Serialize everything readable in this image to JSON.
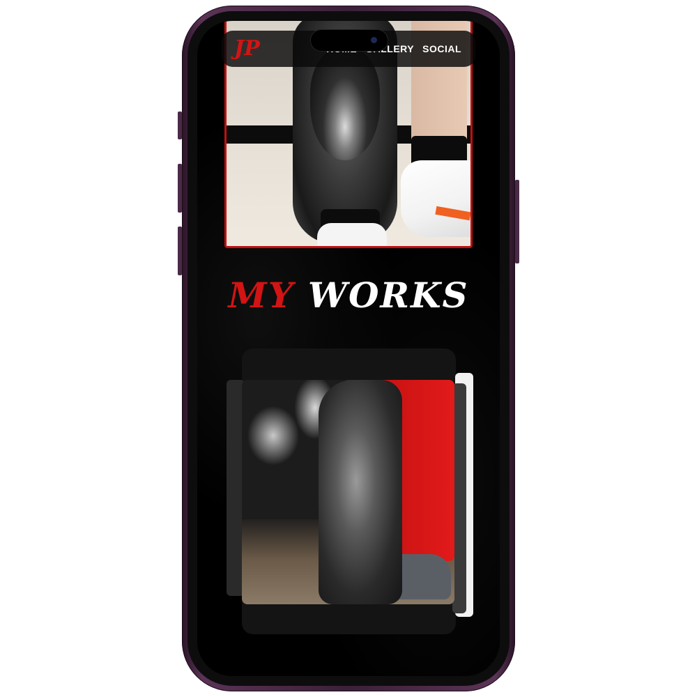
{
  "nav": {
    "logo": "JP",
    "links": [
      "HOME",
      "GALLERY",
      "SOCIAL"
    ]
  },
  "heading": {
    "part1": "MY",
    "part2": "WORKS"
  },
  "colors": {
    "accent": "#d21414",
    "background": "#000000",
    "phone_frame": "#4a2a47"
  },
  "images": {
    "hero": "tiger-tattoo-leg-photo",
    "gallery": "woman-snake-tattoo-leg-photo"
  }
}
